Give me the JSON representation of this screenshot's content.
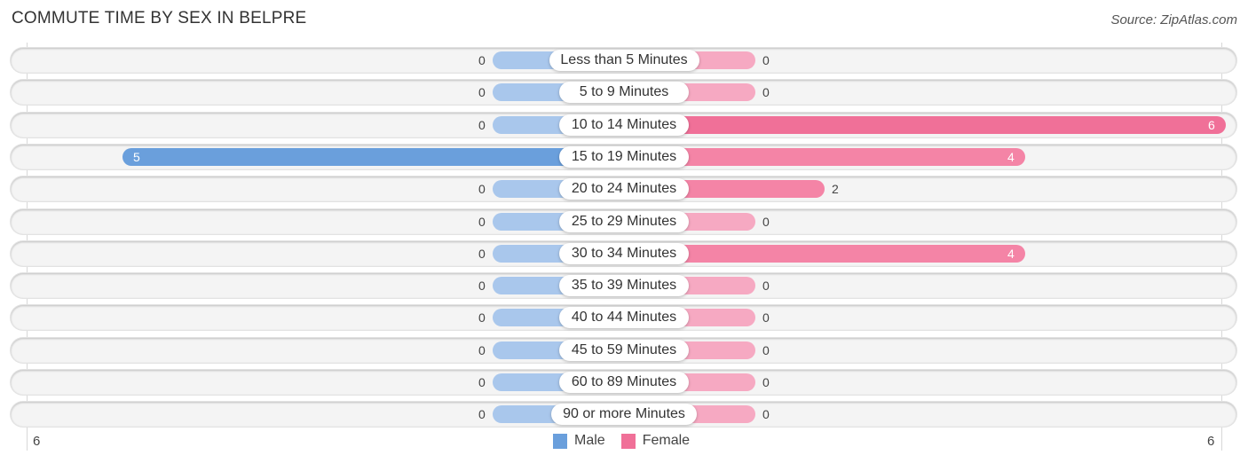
{
  "title": "COMMUTE TIME BY SEX IN BELPRE",
  "source": "Source: ZipAtlas.com",
  "colors": {
    "male": "#6a9fdc",
    "male_zero": "#a9c7ec",
    "female": "#f07098",
    "female_zero": "#f6a9c2"
  },
  "chart_data": {
    "type": "bar",
    "orientation": "horizontal-diverging",
    "title": "COMMUTE TIME BY SEX IN BELPRE",
    "categories": [
      "Less than 5 Minutes",
      "5 to 9 Minutes",
      "10 to 14 Minutes",
      "15 to 19 Minutes",
      "20 to 24 Minutes",
      "25 to 29 Minutes",
      "30 to 34 Minutes",
      "35 to 39 Minutes",
      "40 to 44 Minutes",
      "45 to 59 Minutes",
      "60 to 89 Minutes",
      "90 or more Minutes"
    ],
    "series": [
      {
        "name": "Male",
        "values": [
          0,
          0,
          0,
          5,
          0,
          0,
          0,
          0,
          0,
          0,
          0,
          0
        ]
      },
      {
        "name": "Female",
        "values": [
          0,
          0,
          6,
          4,
          2,
          0,
          4,
          0,
          0,
          0,
          0,
          0
        ]
      }
    ],
    "axis": {
      "left_tick": "6",
      "right_tick": "6",
      "xlim": [
        -6,
        6
      ]
    },
    "legend": [
      "Male",
      "Female"
    ],
    "legend_position": "bottom-center",
    "grid": false
  }
}
